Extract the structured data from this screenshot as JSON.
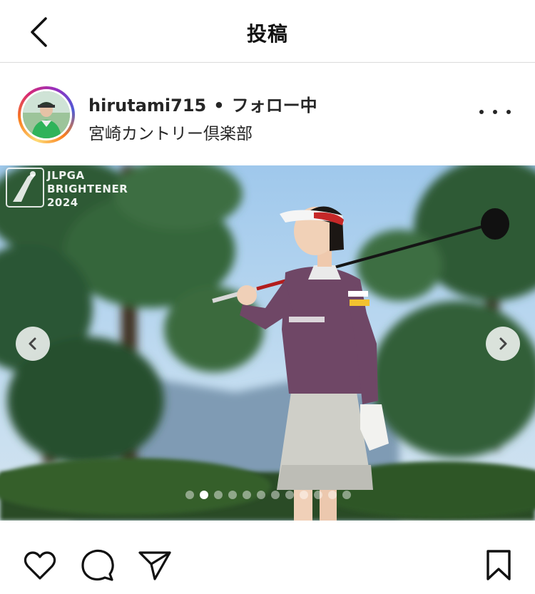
{
  "header": {
    "title": "投稿",
    "back_icon": "chevron-left-icon"
  },
  "post": {
    "username": "hirutami715",
    "separator": "•",
    "follow_status": "フォロー中",
    "location": "宮崎カントリー倶楽部",
    "more_icon": "more-horizontal-icon"
  },
  "photo": {
    "watermark_line1": "JLPGA",
    "watermark_line2": "BRIGHTENER",
    "watermark_line3": "2024",
    "carousel_count": 12,
    "carousel_active_index": 1
  },
  "actions": {
    "like_icon": "heart-icon",
    "comment_icon": "comment-icon",
    "share_icon": "send-icon",
    "save_icon": "bookmark-icon"
  },
  "colors": {
    "text": "#262626",
    "divider": "#dbdbdb",
    "story_ring": [
      "#feda75",
      "#fa7e1e",
      "#d62976",
      "#962fbf",
      "#4f5bd5"
    ]
  }
}
